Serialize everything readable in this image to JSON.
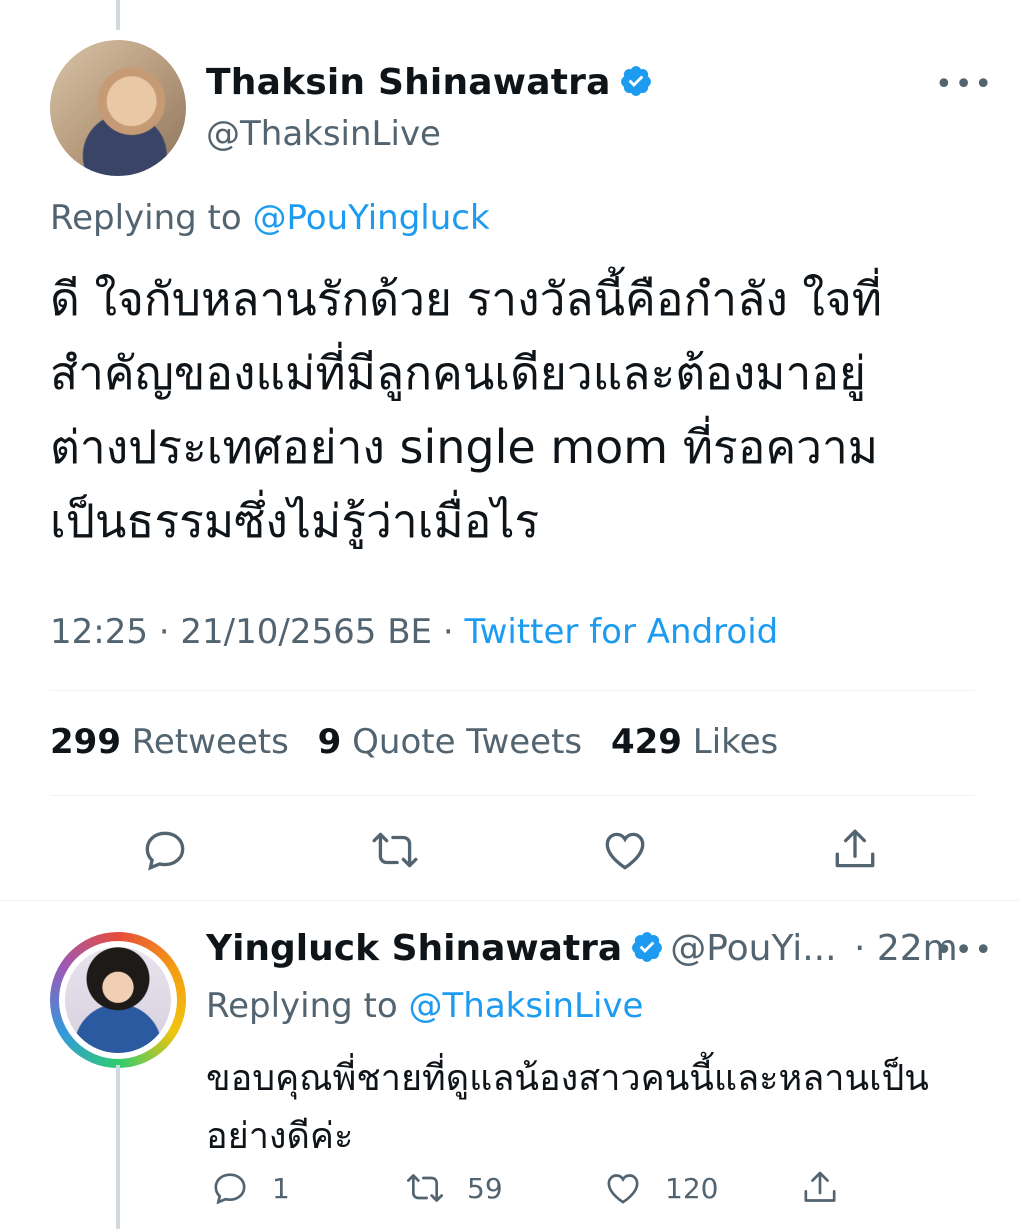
{
  "main_tweet": {
    "author_name": "Thaksin Shinawatra",
    "author_handle": "@ThaksinLive",
    "replying_to_label": "Replying to",
    "replying_to_handle": "@PouYingluck",
    "text_lines": [
      "ดี ใจกับหลานรักด้วย รางวัลนี้คือกำลัง ใจที่",
      "สำคัญของแม่ที่มีลูกคนเดียวและต้องมาอยู่",
      "ต่างประเทศอย่าง single mom ที่รอความ",
      "เป็นธรรมซึ่งไม่รู้ว่าเมื่อไร"
    ],
    "time": "12:25",
    "date": "21/10/2565 BE",
    "source": "Twitter for Android",
    "stats": {
      "retweets_count": "299",
      "retweets_label": "Retweets",
      "quotes_count": "9",
      "quotes_label": "Quote Tweets",
      "likes_count": "429",
      "likes_label": "Likes"
    },
    "more_icon": "•••"
  },
  "reply_tweet": {
    "author_name": "Yingluck Shinawatra",
    "author_handle": "@PouYi...",
    "age": "22m",
    "replying_to_label": "Replying to",
    "replying_to_handle": "@ThaksinLive",
    "text_lines": [
      "ขอบคุณพี่ชายที่ดูแลน้องสาวคนนี้และหลานเป็น",
      "อย่างดีค่ะ"
    ],
    "reply_count": "1",
    "retweet_count": "59",
    "like_count": "120",
    "more_icon": "•••"
  },
  "colors": {
    "accent": "#1d9bf0",
    "secondary_text": "#536471",
    "primary_text": "#0f1419",
    "divider": "#eff3f4"
  },
  "icons": [
    "verified-badge-icon",
    "more-icon",
    "reply-icon",
    "retweet-icon",
    "like-icon",
    "share-icon"
  ]
}
